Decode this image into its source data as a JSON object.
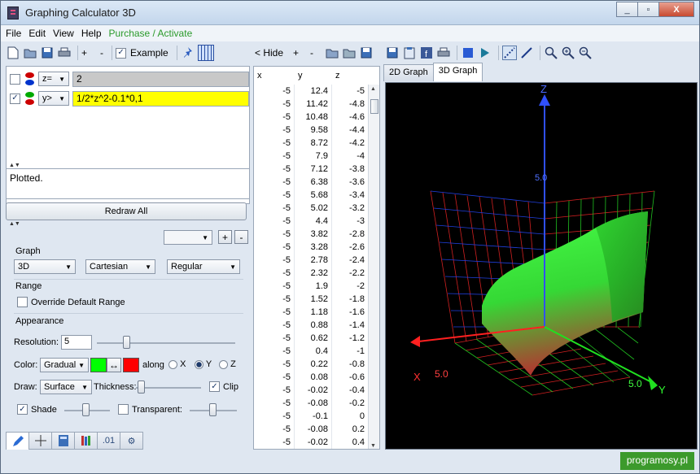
{
  "window": {
    "title": "Graphing Calculator 3D",
    "buttons": [
      "_",
      "▫",
      "X"
    ]
  },
  "menu": {
    "items": [
      "File",
      "Edit",
      "View",
      "Help"
    ],
    "accent": "Purchase / Activate"
  },
  "toolbar": {
    "example_label": "Example",
    "plus": "+",
    "minus": "-"
  },
  "equations": [
    {
      "checked": false,
      "type": "z=",
      "value": "2",
      "color_top": "#cc0000",
      "color_bottom": "#0033cc"
    },
    {
      "checked": true,
      "type": "y>",
      "value": "1/2*z^2-0.1*0,1",
      "color_top": "#00aa00",
      "color_bottom": "#cc0000"
    }
  ],
  "status": {
    "message": "Plotted."
  },
  "redraw_label": "Redraw All",
  "settings": {
    "graph_label": "Graph",
    "graph_mode": "3D",
    "coord_system": "Cartesian",
    "plot_style": "Regular",
    "range_label": "Range",
    "override_label": "Override Default Range",
    "appearance_label": "Appearance",
    "resolution_label": "Resolution:",
    "resolution_value": "5",
    "color_label": "Color:",
    "color_mode": "Gradual",
    "color_start": "#00ff00",
    "color_end": "#ff0000",
    "swap_label": "↔",
    "along_label": "along",
    "axis_options": [
      "X",
      "Y",
      "Z"
    ],
    "draw_label": "Draw:",
    "draw_mode": "Surface",
    "thickness_label": "Thickness:",
    "clip_label": "Clip",
    "shade_label": "Shade",
    "transparent_label": "Transparent:"
  },
  "table": {
    "hide_label": "< Hide",
    "plus": "+",
    "minus": "-",
    "headers": [
      "x",
      "y",
      "z"
    ],
    "rows": [
      [
        "-5",
        "12.4",
        "-5"
      ],
      [
        "-5",
        "11.42",
        "-4.8"
      ],
      [
        "-5",
        "10.48",
        "-4.6"
      ],
      [
        "-5",
        "9.58",
        "-4.4"
      ],
      [
        "-5",
        "8.72",
        "-4.2"
      ],
      [
        "-5",
        "7.9",
        "-4"
      ],
      [
        "-5",
        "7.12",
        "-3.8"
      ],
      [
        "-5",
        "6.38",
        "-3.6"
      ],
      [
        "-5",
        "5.68",
        "-3.4"
      ],
      [
        "-5",
        "5.02",
        "-3.2"
      ],
      [
        "-5",
        "4.4",
        "-3"
      ],
      [
        "-5",
        "3.82",
        "-2.8"
      ],
      [
        "-5",
        "3.28",
        "-2.6"
      ],
      [
        "-5",
        "2.78",
        "-2.4"
      ],
      [
        "-5",
        "2.32",
        "-2.2"
      ],
      [
        "-5",
        "1.9",
        "-2"
      ],
      [
        "-5",
        "1.52",
        "-1.8"
      ],
      [
        "-5",
        "1.18",
        "-1.6"
      ],
      [
        "-5",
        "0.88",
        "-1.4"
      ],
      [
        "-5",
        "0.62",
        "-1.2"
      ],
      [
        "-5",
        "0.4",
        "-1"
      ],
      [
        "-5",
        "0.22",
        "-0.8"
      ],
      [
        "-5",
        "0.08",
        "-0.6"
      ],
      [
        "-5",
        "-0.02",
        "-0.4"
      ],
      [
        "-5",
        "-0.08",
        "-0.2"
      ],
      [
        "-5",
        "-0.1",
        "0"
      ],
      [
        "-5",
        "-0.08",
        "0.2"
      ],
      [
        "-5",
        "-0.02",
        "0.4"
      ]
    ]
  },
  "graph": {
    "tabs": [
      "2D Graph",
      "3D Graph"
    ],
    "active_tab": "3D Graph",
    "axis_labels": {
      "x": "X",
      "y": "Y",
      "z": "Z"
    },
    "tick_labels": {
      "x": "5.0",
      "y": "5.0",
      "z": "5.0"
    }
  },
  "watermark": "programosy.pl"
}
